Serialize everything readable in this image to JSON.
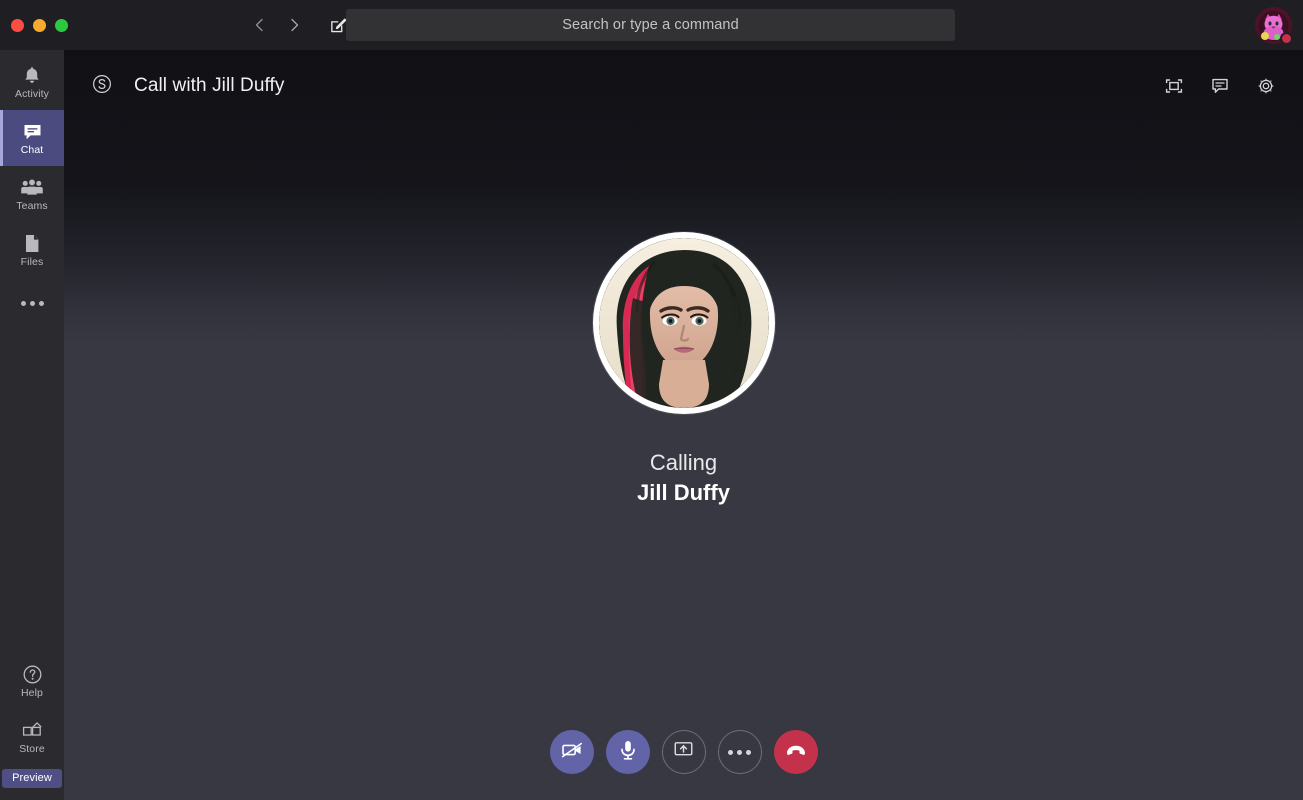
{
  "window": {
    "traffic_lights": [
      "close",
      "minimize",
      "zoom"
    ],
    "colors": {
      "close": "#fa4e44",
      "minimize": "#f6ab2f",
      "zoom": "#2bc93f"
    }
  },
  "titlebar": {
    "back_icon": "chevron-left-icon",
    "forward_icon": "chevron-right-icon",
    "compose_icon": "compose-new-chat-icon",
    "search": {
      "placeholder": "Search or type a command",
      "value": ""
    },
    "profile": {
      "name": "",
      "presence": "busy",
      "presence_color": "#c4314b"
    }
  },
  "rail": {
    "items": [
      {
        "label": "Activity",
        "icon": "bell-icon",
        "active": false
      },
      {
        "label": "Chat",
        "icon": "chat-bubble-icon",
        "active": true
      },
      {
        "label": "Teams",
        "icon": "teams-people-icon",
        "active": false
      },
      {
        "label": "Files",
        "icon": "file-document-icon",
        "active": false
      }
    ],
    "more_icon": "more-ellipsis-icon",
    "bottom_items": [
      {
        "label": "Help",
        "icon": "help-circle-icon"
      },
      {
        "label": "Store",
        "icon": "store-grid-icon"
      }
    ],
    "preview_label": "Preview",
    "active_color": "#4b4b80",
    "preview_color": "#4f4f86"
  },
  "call_header": {
    "app_icon": "skype-icon",
    "title": "Call with Jill Duffy",
    "actions": [
      {
        "name": "fullscreen",
        "icon": "fullscreen-icon"
      },
      {
        "name": "show-conversation",
        "icon": "chat-bubble-icon"
      },
      {
        "name": "settings",
        "icon": "gear-icon"
      }
    ]
  },
  "call": {
    "state": "Calling",
    "contact_name": "Jill Duffy",
    "avatar": "contact-photo",
    "controls": [
      {
        "name": "camera",
        "icon": "camera-off-icon",
        "style": "filled",
        "color": "#6264a7"
      },
      {
        "name": "microphone",
        "icon": "microphone-icon",
        "style": "filled",
        "color": "#6264a7"
      },
      {
        "name": "share-screen",
        "icon": "share-screen-icon",
        "style": "outline"
      },
      {
        "name": "more-options",
        "icon": "more-ellipsis-icon",
        "style": "outline"
      },
      {
        "name": "hang-up",
        "icon": "hang-up-icon",
        "style": "danger",
        "color": "#c4314b"
      }
    ]
  }
}
